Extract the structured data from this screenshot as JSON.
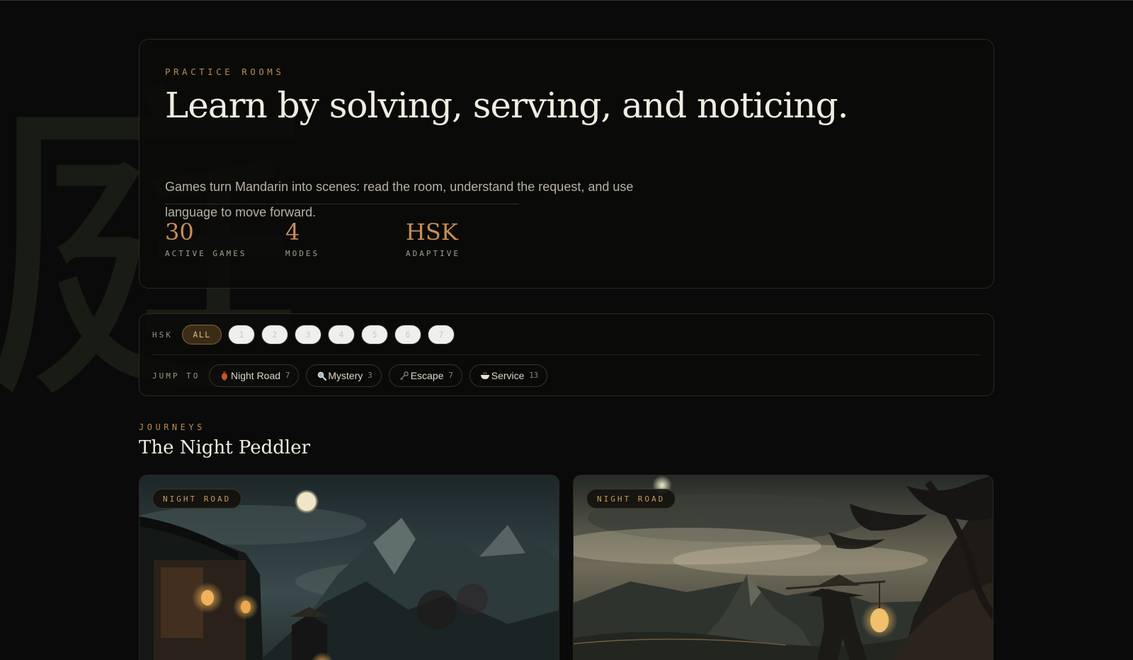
{
  "background_glyph": "庭",
  "hero": {
    "eyebrow": "PRACTICE ROOMS",
    "title": "Learn by solving, serving, and noticing.",
    "description": "Games turn Mandarin into scenes: read the room, understand the request, and use language to move forward.",
    "stats": [
      {
        "value": "30",
        "label": "ACTIVE GAMES"
      },
      {
        "value": "4",
        "label": "MODES"
      },
      {
        "value": "HSK",
        "label": "ADAPTIVE"
      }
    ]
  },
  "filters": {
    "hsk_label": "HSK",
    "levels": [
      "ALL",
      "1",
      "2",
      "3",
      "4",
      "5",
      "6",
      "7"
    ],
    "selected_level": "ALL",
    "jump_label": "JUMP TO",
    "jump_items": [
      {
        "icon": "lantern-icon",
        "label": "Night Road",
        "count": "7"
      },
      {
        "icon": "magnifier-icon",
        "label": "Mystery",
        "count": "3"
      },
      {
        "icon": "key-icon",
        "label": "Escape",
        "count": "7"
      },
      {
        "icon": "bowl-icon",
        "label": "Service",
        "count": "13"
      }
    ]
  },
  "journeys": {
    "eyebrow": "JOURNEYS",
    "title": "The Night Peddler",
    "cards": [
      {
        "tag": "NIGHT ROAD"
      },
      {
        "tag": "NIGHT ROAD"
      }
    ]
  },
  "colors": {
    "background": "#0a0a0a",
    "accent": "#c98d55",
    "panel_border": "#2b2820",
    "text_primary": "#f1ece0"
  }
}
